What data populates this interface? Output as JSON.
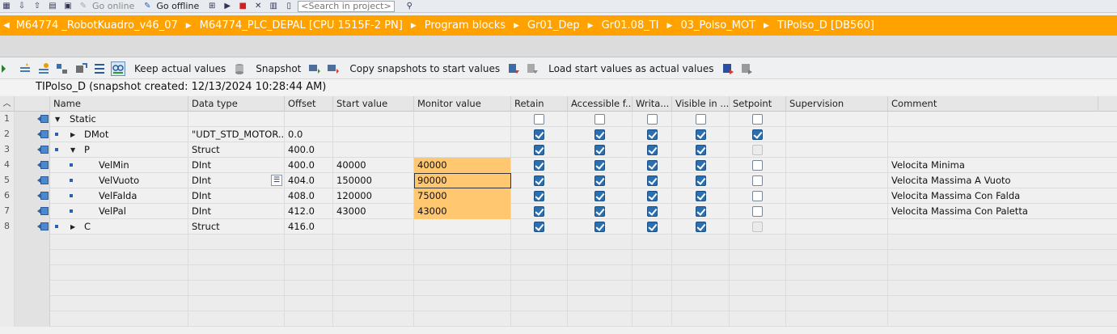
{
  "toolbar": {
    "go_online": "Go online",
    "go_offline": "Go offline",
    "search_placeholder": "<Search in project>"
  },
  "breadcrumb": [
    "M64774 _RobotKuadro_v46_07",
    "M64774_PLC_DEPAL [CPU 1515F-2 PN]",
    "Program blocks",
    "Gr01_Dep",
    "Gr01.08_TI",
    "03_Polso_MOT",
    "TIPolso_D [DB560]"
  ],
  "actions": {
    "keep_actual": "Keep actual values",
    "snapshot": "Snapshot",
    "copy_snapshots": "Copy snapshots to start values",
    "load_start": "Load start values as actual values"
  },
  "snapshot_title": "TIPolso_D (snapshot created: 12/13/2024 10:28:44 AM)",
  "columns": [
    "Name",
    "Data type",
    "Offset",
    "Start value",
    "Monitor value",
    "Retain",
    "Accessible f...",
    "Writa...",
    "Visible in ...",
    "Setpoint",
    "Supervision",
    "Comment"
  ],
  "rows": [
    {
      "num": "1",
      "name": "Static",
      "type": "",
      "offset": "",
      "start": "",
      "monitor": "",
      "retain": false,
      "access": false,
      "write": false,
      "visible": false,
      "setpoint": false,
      "comment": ""
    },
    {
      "num": "2",
      "name": "DMot",
      "type": "\"UDT_STD_MOTOR...",
      "offset": "0.0",
      "start": "",
      "monitor": "",
      "retain": true,
      "access": true,
      "write": true,
      "visible": true,
      "setpoint": true,
      "comment": ""
    },
    {
      "num": "3",
      "name": "P",
      "type": "Struct",
      "offset": "400.0",
      "start": "",
      "monitor": "",
      "retain": true,
      "access": true,
      "write": true,
      "visible": true,
      "setpoint": false,
      "comment": ""
    },
    {
      "num": "4",
      "name": "VelMin",
      "type": "DInt",
      "offset": "400.0",
      "start": "40000",
      "monitor": "40000",
      "retain": true,
      "access": true,
      "write": true,
      "visible": true,
      "setpoint": false,
      "comment": "Velocita Minima"
    },
    {
      "num": "5",
      "name": "VelVuoto",
      "type": "DInt",
      "offset": "404.0",
      "start": "150000",
      "monitor": "90000",
      "retain": true,
      "access": true,
      "write": true,
      "visible": true,
      "setpoint": false,
      "comment": "Velocita Massima A Vuoto"
    },
    {
      "num": "6",
      "name": "VelFalda",
      "type": "DInt",
      "offset": "408.0",
      "start": "120000",
      "monitor": "75000",
      "retain": true,
      "access": true,
      "write": true,
      "visible": true,
      "setpoint": false,
      "comment": "Velocita Massima Con Falda"
    },
    {
      "num": "7",
      "name": "VelPal",
      "type": "DInt",
      "offset": "412.0",
      "start": "43000",
      "monitor": "43000",
      "retain": true,
      "access": true,
      "write": true,
      "visible": true,
      "setpoint": false,
      "comment": "Velocita Massima Con Paletta"
    },
    {
      "num": "8",
      "name": "C",
      "type": "Struct",
      "offset": "416.0",
      "start": "",
      "monitor": "",
      "retain": true,
      "access": true,
      "write": true,
      "visible": true,
      "setpoint": false,
      "comment": ""
    }
  ]
}
